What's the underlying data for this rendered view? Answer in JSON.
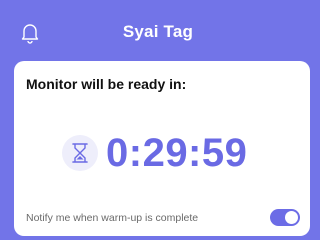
{
  "header": {
    "title": "Syai Tag",
    "bell_icon": "bell-icon"
  },
  "card": {
    "heading": "Monitor will be ready in:",
    "hourglass_icon": "hourglass-icon",
    "countdown": "0:29:59",
    "notify_label": "Notify me when warm-up is complete",
    "notify_enabled": true
  },
  "colors": {
    "background": "#7274e8",
    "accent": "#6a6ae4",
    "card": "#ffffff"
  }
}
